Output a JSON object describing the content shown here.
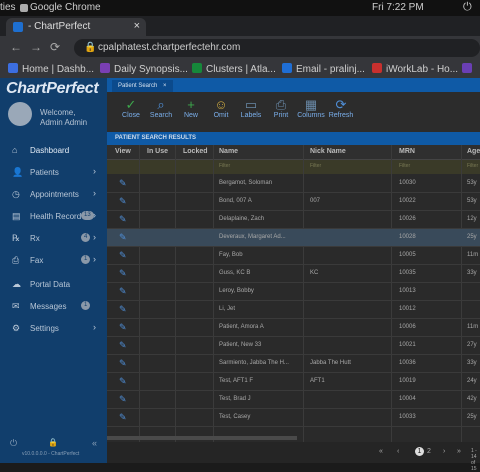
{
  "os": {
    "left_text": "ties",
    "browser": "Google Chrome",
    "time": "Fri 7:22 PM"
  },
  "browser": {
    "tab_title": "- ChartPerfect",
    "url": "cpalphatest.chartperfectehr.com",
    "bookmarks": [
      {
        "label": "Home | Dashb...",
        "color": "#3c6ee0"
      },
      {
        "label": "Daily Synopsis...",
        "color": "#7a3fb4"
      },
      {
        "label": "Clusters | Atla...",
        "color": "#16883a"
      },
      {
        "label": "Email - pralinj...",
        "color": "#1f6ed4"
      },
      {
        "label": "iWorkLab - Ho...",
        "color": "#c8302e"
      },
      {
        "label": "",
        "color": "#6a3fb4"
      }
    ]
  },
  "sidebar": {
    "logo": "ChartPerfect",
    "welcome_line1": "Welcome,",
    "welcome_line2": "Admin Admin",
    "items": [
      {
        "label": "Dashboard",
        "icon": "⌂",
        "chevron": "",
        "badge": ""
      },
      {
        "label": "Patients",
        "icon": "👤",
        "chevron": "›",
        "badge": ""
      },
      {
        "label": "Appointments",
        "icon": "◷",
        "chevron": "›",
        "badge": ""
      },
      {
        "label": "Health Record",
        "icon": "▤",
        "chevron": "›",
        "badge": "13"
      },
      {
        "label": "Rx",
        "icon": "℞",
        "chevron": "›",
        "badge": "4"
      },
      {
        "label": "Fax",
        "icon": "⎙",
        "chevron": "›",
        "badge": "1"
      },
      {
        "label": "Portal Data",
        "icon": "☁",
        "chevron": "",
        "badge": ""
      },
      {
        "label": "Messages",
        "icon": "✉",
        "chevron": "",
        "badge": "1"
      },
      {
        "label": "Settings",
        "icon": "⚙",
        "chevron": "›",
        "badge": ""
      }
    ],
    "footer": "v10.0.0.0.0 - ChartPerfect"
  },
  "main": {
    "page_tab": "Patient Search",
    "page_tab_close": "×",
    "toolbar": [
      {
        "label": "Close",
        "glyph": "✓"
      },
      {
        "label": "Search",
        "glyph": "⌕"
      },
      {
        "label": "New",
        "glyph": "+"
      },
      {
        "label": "Omit",
        "glyph": "☺"
      },
      {
        "label": "Labels",
        "glyph": "▭"
      },
      {
        "label": "Print",
        "glyph": "⎙"
      },
      {
        "label": "Columns",
        "glyph": "▦"
      },
      {
        "label": "Refresh",
        "glyph": "⟳"
      }
    ],
    "section_title": "PATIENT SEARCH RESULTS",
    "columns": [
      "View",
      "In Use",
      "Locked",
      "Name",
      "Nick Name",
      "MRN",
      "Age"
    ],
    "filter_placeholder": "Filter",
    "rows": [
      {
        "name": "Bergamot, Soloman",
        "nick": "",
        "mrn": "10030",
        "age": "53y"
      },
      {
        "name": "Bond, 007 A",
        "nick": "007",
        "mrn": "10022",
        "age": "53y"
      },
      {
        "name": "Delaplaine, Zach",
        "nick": "",
        "mrn": "10026",
        "age": "12y"
      },
      {
        "name": "Deveraux, Margaret Ad...",
        "nick": "",
        "mrn": "10028",
        "age": "25y"
      },
      {
        "name": "Fay, Bob",
        "nick": "",
        "mrn": "10005",
        "age": "11m"
      },
      {
        "name": "Guss, KC B",
        "nick": "KC",
        "mrn": "10035",
        "age": "33y"
      },
      {
        "name": "Leroy, Bobby",
        "nick": "",
        "mrn": "10013",
        "age": ""
      },
      {
        "name": "Li, Jet",
        "nick": "",
        "mrn": "10012",
        "age": ""
      },
      {
        "name": "Patient, Amora A",
        "nick": "",
        "mrn": "10006",
        "age": "11m"
      },
      {
        "name": "Patient, New 33",
        "nick": "",
        "mrn": "10021",
        "age": "27y"
      },
      {
        "name": "Sarmiento, Jabba The H...",
        "nick": "Jabba The Hutt",
        "mrn": "10036",
        "age": "33y"
      },
      {
        "name": "Test, AFT1 F",
        "nick": "AFT1",
        "mrn": "10019",
        "age": "24y"
      },
      {
        "name": "Test, Brad J",
        "nick": "",
        "mrn": "10004",
        "age": "42y"
      },
      {
        "name": "Test, Casey",
        "nick": "",
        "mrn": "10033",
        "age": "25y"
      }
    ],
    "pager": {
      "prev2": "«",
      "prev": "‹",
      "page1": "1",
      "page2": "2",
      "next": "›",
      "next2": "»",
      "info": "1 - 14 of 15"
    }
  }
}
